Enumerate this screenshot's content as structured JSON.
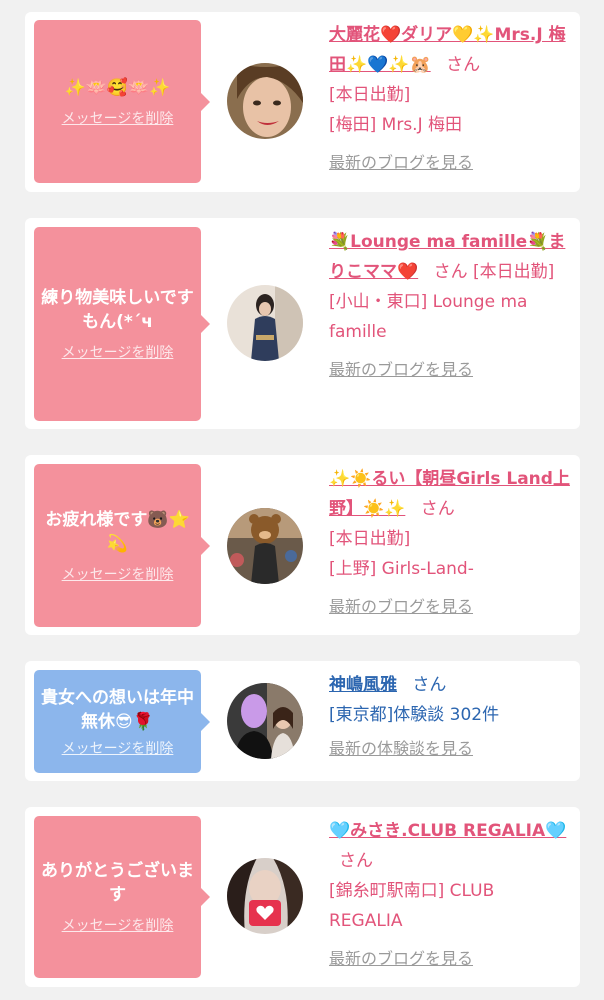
{
  "cards": [
    {
      "message": "✨🪷🥰🪷✨",
      "delete_label": "メッセージを削除",
      "name": "大麗花❤️ダリア💛✨Mrs.J 梅田✨💙✨🐹",
      "honorific": "さん",
      "status": "[本日出勤]",
      "location": "[梅田] Mrs.J 梅田",
      "link": "最新のブログを見る"
    },
    {
      "message": "練り物美味しいですもん(*´ч",
      "delete_label": "メッセージを削除",
      "name": "💐Lounge ma famille💐まりこママ❤️",
      "honorific": "さん",
      "status": "[本日出勤]",
      "location": "[小山・東口] Lounge ma famille",
      "link": "最新のブログを見る"
    },
    {
      "message": "お疲れ様です🐻⭐💫",
      "delete_label": "メッセージを削除",
      "name": "✨☀️るい【朝昼Girls Land上野】☀️✨",
      "honorific": "さん",
      "status": "[本日出勤]",
      "location": "[上野] Girls-Land-",
      "link": "最新のブログを見る"
    },
    {
      "message": "貴女への想いは年中無休😎🌹",
      "delete_label": "メッセージを削除",
      "name": "神嶋風雅",
      "honorific": "さん",
      "status": "[東京都]体験談 302件",
      "link": "最新の体験談を見る"
    },
    {
      "message": "ありがとうございます",
      "delete_label": "メッセージを削除",
      "name": "🩵みさき.CLUB REGALIA🩵",
      "honorific": "さん",
      "location": "[錦糸町駅南口] CLUB REGALIA",
      "link": "最新のブログを見る"
    }
  ],
  "colors": {
    "pink_bubble": "#f4919c",
    "blue_bubble": "#8cb6ec",
    "pink_text": "#e2547a",
    "blue_text": "#2c66b0"
  }
}
